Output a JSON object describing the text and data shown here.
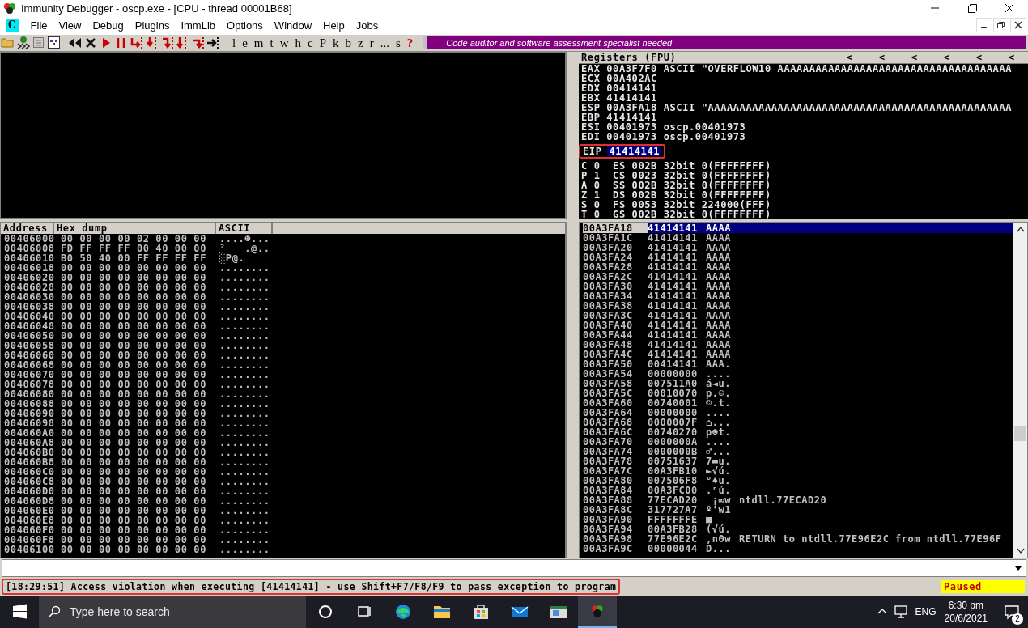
{
  "window": {
    "title": "Immunity Debugger - oscp.exe - [CPU - thread 00001B68]"
  },
  "menu": {
    "app_glyph": "C",
    "items": [
      "File",
      "View",
      "Debug",
      "Plugins",
      "ImmLib",
      "Options",
      "Window",
      "Help",
      "Jobs"
    ]
  },
  "toolbar": {
    "letters": [
      "l",
      "e",
      "m",
      "t",
      "w",
      "h",
      "c",
      "P",
      "k",
      "b",
      "z",
      "r",
      "...",
      "s",
      "?"
    ],
    "banner": "Code auditor and software assessment specialist needed"
  },
  "registers": {
    "title": "Registers (FPU)",
    "arrows": [
      "<",
      "<",
      "<",
      "<",
      "<",
      "<"
    ],
    "rows": [
      {
        "kind": "reg",
        "text": "EAX 00A3F7F0 ASCII \"OVERFLOW10 AAAAAAAAAAAAAAAAAAAAAAAAAAAAAAAAAAAAA"
      },
      {
        "kind": "reg",
        "text": "ECX 00A402AC"
      },
      {
        "kind": "reg",
        "text": "EDX 00414141"
      },
      {
        "kind": "reg",
        "text": "EBX 41414141"
      },
      {
        "kind": "reg",
        "text": "ESP 00A3FA18 ASCII \"AAAAAAAAAAAAAAAAAAAAAAAAAAAAAAAAAAAAAAAAAAAAAAAA"
      },
      {
        "kind": "reg",
        "text": "EBP 41414141"
      },
      {
        "kind": "reg",
        "text": "ESI 00401973 oscp.00401973"
      },
      {
        "kind": "reg",
        "text": "EDI 00401973 oscp.00401973"
      },
      {
        "kind": "eip",
        "name": "EIP",
        "value": "41414141",
        "selected": true,
        "annotated": true
      },
      {
        "kind": "reg",
        "text": "C 0  ES 002B 32bit 0(FFFFFFFF)"
      },
      {
        "kind": "reg",
        "text": "P 1  CS 0023 32bit 0(FFFFFFFF)"
      },
      {
        "kind": "reg",
        "text": "A 0  SS 002B 32bit 0(FFFFFFFF)"
      },
      {
        "kind": "reg",
        "text": "Z 1  DS 002B 32bit 0(FFFFFFFF)"
      },
      {
        "kind": "reg",
        "text": "S 0  FS 0053 32bit 224000(FFF)"
      },
      {
        "kind": "reg",
        "text": "T 0  GS 002B 32bit 0(FFFFFFFF)"
      }
    ]
  },
  "dump": {
    "columns": [
      "Address",
      "Hex dump",
      "ASCII"
    ],
    "rows": [
      {
        "address": "00406000",
        "hex": "00 00 00 00 02 00 00 00",
        "ascii": "....☻..."
      },
      {
        "address": "00406008",
        "hex": "FD FF FF FF 00 40 00 00",
        "ascii": "²   .@.."
      },
      {
        "address": "00406010",
        "hex": "B0 50 40 00 FF FF FF FF",
        "ascii": "░P@."
      },
      {
        "address": "00406018",
        "hex": "00 00 00 00 00 00 00 00",
        "ascii": "........"
      },
      {
        "address": "00406020",
        "hex": "00 00 00 00 00 00 00 00",
        "ascii": "........"
      },
      {
        "address": "00406028",
        "hex": "00 00 00 00 00 00 00 00",
        "ascii": "........"
      },
      {
        "address": "00406030",
        "hex": "00 00 00 00 00 00 00 00",
        "ascii": "........"
      },
      {
        "address": "00406038",
        "hex": "00 00 00 00 00 00 00 00",
        "ascii": "........"
      },
      {
        "address": "00406040",
        "hex": "00 00 00 00 00 00 00 00",
        "ascii": "........"
      },
      {
        "address": "00406048",
        "hex": "00 00 00 00 00 00 00 00",
        "ascii": "........"
      },
      {
        "address": "00406050",
        "hex": "00 00 00 00 00 00 00 00",
        "ascii": "........"
      },
      {
        "address": "00406058",
        "hex": "00 00 00 00 00 00 00 00",
        "ascii": "........"
      },
      {
        "address": "00406060",
        "hex": "00 00 00 00 00 00 00 00",
        "ascii": "........"
      },
      {
        "address": "00406068",
        "hex": "00 00 00 00 00 00 00 00",
        "ascii": "........"
      },
      {
        "address": "00406070",
        "hex": "00 00 00 00 00 00 00 00",
        "ascii": "........"
      },
      {
        "address": "00406078",
        "hex": "00 00 00 00 00 00 00 00",
        "ascii": "........"
      },
      {
        "address": "00406080",
        "hex": "00 00 00 00 00 00 00 00",
        "ascii": "........"
      },
      {
        "address": "00406088",
        "hex": "00 00 00 00 00 00 00 00",
        "ascii": "........"
      },
      {
        "address": "00406090",
        "hex": "00 00 00 00 00 00 00 00",
        "ascii": "........"
      },
      {
        "address": "00406098",
        "hex": "00 00 00 00 00 00 00 00",
        "ascii": "........"
      },
      {
        "address": "004060A0",
        "hex": "00 00 00 00 00 00 00 00",
        "ascii": "........"
      },
      {
        "address": "004060A8",
        "hex": "00 00 00 00 00 00 00 00",
        "ascii": "........"
      },
      {
        "address": "004060B0",
        "hex": "00 00 00 00 00 00 00 00",
        "ascii": "........"
      },
      {
        "address": "004060B8",
        "hex": "00 00 00 00 00 00 00 00",
        "ascii": "........"
      },
      {
        "address": "004060C0",
        "hex": "00 00 00 00 00 00 00 00",
        "ascii": "........"
      },
      {
        "address": "004060C8",
        "hex": "00 00 00 00 00 00 00 00",
        "ascii": "........"
      },
      {
        "address": "004060D0",
        "hex": "00 00 00 00 00 00 00 00",
        "ascii": "........"
      },
      {
        "address": "004060D8",
        "hex": "00 00 00 00 00 00 00 00",
        "ascii": "........"
      },
      {
        "address": "004060E0",
        "hex": "00 00 00 00 00 00 00 00",
        "ascii": "........"
      },
      {
        "address": "004060E8",
        "hex": "00 00 00 00 00 00 00 00",
        "ascii": "........"
      },
      {
        "address": "004060F0",
        "hex": "00 00 00 00 00 00 00 00",
        "ascii": "........"
      },
      {
        "address": "004060F8",
        "hex": "00 00 00 00 00 00 00 00",
        "ascii": "........"
      },
      {
        "address": "00406100",
        "hex": "00 00 00 00 00 00 00 00",
        "ascii": "........"
      }
    ]
  },
  "stack": {
    "rows": [
      {
        "address": "00A3FA18",
        "value": "41414141",
        "ascii": "AAAA",
        "selected": true
      },
      {
        "address": "00A3FA1C",
        "value": "41414141",
        "ascii": "AAAA",
        "selected": false
      },
      {
        "address": "00A3FA20",
        "value": "41414141",
        "ascii": "AAAA",
        "selected": false
      },
      {
        "address": "00A3FA24",
        "value": "41414141",
        "ascii": "AAAA",
        "selected": false
      },
      {
        "address": "00A3FA28",
        "value": "41414141",
        "ascii": "AAAA",
        "selected": false
      },
      {
        "address": "00A3FA2C",
        "value": "41414141",
        "ascii": "AAAA",
        "selected": false
      },
      {
        "address": "00A3FA30",
        "value": "41414141",
        "ascii": "AAAA",
        "selected": false
      },
      {
        "address": "00A3FA34",
        "value": "41414141",
        "ascii": "AAAA",
        "selected": false
      },
      {
        "address": "00A3FA38",
        "value": "41414141",
        "ascii": "AAAA",
        "selected": false
      },
      {
        "address": "00A3FA3C",
        "value": "41414141",
        "ascii": "AAAA",
        "selected": false
      },
      {
        "address": "00A3FA40",
        "value": "41414141",
        "ascii": "AAAA",
        "selected": false
      },
      {
        "address": "00A3FA44",
        "value": "41414141",
        "ascii": "AAAA",
        "selected": false
      },
      {
        "address": "00A3FA48",
        "value": "41414141",
        "ascii": "AAAA",
        "selected": false
      },
      {
        "address": "00A3FA4C",
        "value": "41414141",
        "ascii": "AAAA",
        "selected": false
      },
      {
        "address": "00A3FA50",
        "value": "00414141",
        "ascii": "AAA.",
        "selected": false
      },
      {
        "address": "00A3FA54",
        "value": "00000000",
        "ascii": "....",
        "selected": false
      },
      {
        "address": "00A3FA58",
        "value": "007511A0",
        "ascii": "á◄u.",
        "selected": false
      },
      {
        "address": "00A3FA5C",
        "value": "00010070",
        "ascii": "p.☺.",
        "selected": false
      },
      {
        "address": "00A3FA60",
        "value": "00740001",
        "ascii": "☺.t.",
        "selected": false
      },
      {
        "address": "00A3FA64",
        "value": "00000000",
        "ascii": "....",
        "selected": false
      },
      {
        "address": "00A3FA68",
        "value": "0000007F",
        "ascii": "⌂...",
        "selected": false
      },
      {
        "address": "00A3FA6C",
        "value": "00740270",
        "ascii": "p☻t.",
        "selected": false
      },
      {
        "address": "00A3FA70",
        "value": "0000000A",
        "ascii": "....",
        "selected": false
      },
      {
        "address": "00A3FA74",
        "value": "0000000B",
        "ascii": "♂...",
        "selected": false
      },
      {
        "address": "00A3FA78",
        "value": "00751637",
        "ascii": "7▬u.",
        "selected": false
      },
      {
        "address": "00A3FA7C",
        "value": "00A3FB10",
        "ascii": "►√ú.",
        "selected": false
      },
      {
        "address": "00A3FA80",
        "value": "007506F8",
        "ascii": "°♠u.",
        "selected": false
      },
      {
        "address": "00A3FA84",
        "value": "00A3FC00",
        "ascii": ".ⁿú.",
        "selected": false
      },
      {
        "address": "00A3FA88",
        "value": "77ECAD20",
        "ascii": " ¡∞w",
        "comment": "ntdll.77ECAD20",
        "selected": false
      },
      {
        "address": "00A3FA8C",
        "value": "317727A7",
        "ascii": "º'w1",
        "selected": false
      },
      {
        "address": "00A3FA90",
        "value": "FFFFFFFE",
        "ascii": "■",
        "selected": false
      },
      {
        "address": "00A3FA94",
        "value": "00A3FB28",
        "ascii": "(√ú.",
        "selected": false
      },
      {
        "address": "00A3FA98",
        "value": "77E96E2C",
        "ascii": ",nΘw",
        "comment": "RETURN to ntdll.77E96E2C from ntdll.77E96F",
        "selected": false
      },
      {
        "address": "00A3FA9C",
        "value": "00000044",
        "ascii": "D...",
        "selected": false
      }
    ]
  },
  "status": {
    "message": "[18:29:51] Access violation when executing [41414141] - use Shift+F7/F8/F9 to pass exception to program",
    "annotated": true,
    "state": "Paused"
  },
  "taskbar": {
    "search_placeholder": "Type here to search",
    "language": "ENG",
    "time": "6:30 pm",
    "date": "20/6/2021",
    "notifications": "2"
  }
}
